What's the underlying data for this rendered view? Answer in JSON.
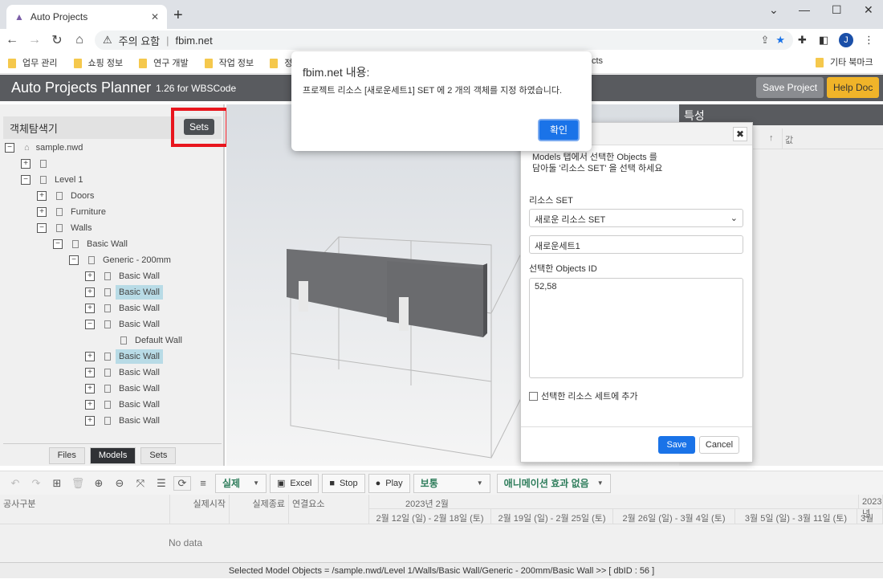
{
  "browser": {
    "tab_title": "Auto Projects",
    "security": "주의 요함",
    "url": "fbim.net",
    "avatar": "J",
    "bookmarks": [
      "업무 관리",
      "쇼핑 정보",
      "연구 개발",
      "작업 정보",
      "정보"
    ],
    "bookmark_partial": "cts",
    "other_bookmarks": "기타 북마크"
  },
  "app": {
    "title": "Auto Projects Planner",
    "version": "1.26 for WBSCode",
    "save_project": "Save Project",
    "help_doc": "Help Doc",
    "accent": "#f0b429"
  },
  "explorer": {
    "title": "객체탐색기",
    "sets_button": "Sets",
    "tree": [
      {
        "level": 0,
        "toggle": "−",
        "icon": "home",
        "label": "sample.nwd"
      },
      {
        "level": 1,
        "toggle": "+",
        "icon": "doc",
        "label": ""
      },
      {
        "level": 1,
        "toggle": "−",
        "icon": "doc",
        "label": "Level 1"
      },
      {
        "level": 2,
        "toggle": "+",
        "icon": "doc",
        "label": "Doors"
      },
      {
        "level": 2,
        "toggle": "+",
        "icon": "doc",
        "label": "Furniture"
      },
      {
        "level": 2,
        "toggle": "−",
        "icon": "doc",
        "label": "Walls"
      },
      {
        "level": 3,
        "toggle": "−",
        "icon": "doc",
        "label": "Basic Wall"
      },
      {
        "level": 4,
        "toggle": "−",
        "icon": "doc",
        "label": "Generic - 200mm"
      },
      {
        "level": 5,
        "toggle": "+",
        "icon": "doc",
        "label": "Basic Wall"
      },
      {
        "level": 5,
        "toggle": "+",
        "icon": "doc",
        "label": "Basic Wall",
        "selected": true
      },
      {
        "level": 5,
        "toggle": "+",
        "icon": "doc",
        "label": "Basic Wall"
      },
      {
        "level": 5,
        "toggle": "−",
        "icon": "doc",
        "label": "Basic Wall"
      },
      {
        "level": 6,
        "toggle": "",
        "icon": "doc",
        "label": "Default Wall"
      },
      {
        "level": 5,
        "toggle": "+",
        "icon": "doc",
        "label": "Basic Wall",
        "selected": true
      },
      {
        "level": 5,
        "toggle": "+",
        "icon": "doc",
        "label": "Basic Wall"
      },
      {
        "level": 5,
        "toggle": "+",
        "icon": "doc",
        "label": "Basic Wall"
      },
      {
        "level": 5,
        "toggle": "+",
        "icon": "doc",
        "label": "Basic Wall"
      },
      {
        "level": 5,
        "toggle": "+",
        "icon": "doc",
        "label": "Basic Wall"
      }
    ],
    "tabs": [
      {
        "label": "Files"
      },
      {
        "label": "Models",
        "active": true
      },
      {
        "label": "Sets"
      }
    ]
  },
  "properties": {
    "title": "특성",
    "col_value": "값"
  },
  "alert": {
    "title": "fbim.net 내용:",
    "message": "프로젝트 리소스 [새로운세트1] SET 에 2 개의 객체를 지정 하였습니다.",
    "ok": "확인"
  },
  "dialog": {
    "desc1": "Models 탭에서 선택한 Objects 를",
    "desc2": "담아둘 '리소스 SET' 을 선택 하세요",
    "set_label": "리소스 SET",
    "set_select": "새로운 리소스 SET",
    "name_value": "새로운세트1",
    "ids_label": "선택한 Objects ID",
    "ids_value": "52,58",
    "checkbox_label": "선택한 리소스 세트에 추가",
    "checkbox_checked": false,
    "save": "Save",
    "cancel": "Cancel"
  },
  "toolbar": {
    "mode": "실제",
    "excel": "Excel",
    "stop": "Stop",
    "play": "Play",
    "speed": "보통",
    "animation": "애니메이션 효과 없음"
  },
  "gantt": {
    "cols": [
      "공사구분",
      "실제시작",
      "실제종료",
      "연결요소"
    ],
    "month": "2023년 2월",
    "month2": "2023년",
    "weeks": [
      "2월 12일 (일) - 2월 18일 (토)",
      "2월 19일 (일) - 2월 25일 (토)",
      "2월 26일 (일) - 3월 4일 (토)",
      "3월 5일 (일) - 3월 11일 (토)",
      "3월"
    ],
    "empty": "No data"
  },
  "status": "Selected Model Objects = /sample.nwd/Level 1/Walls/Basic Wall/Generic - 200mm/Basic Wall >> [ dbID : 56 ]"
}
